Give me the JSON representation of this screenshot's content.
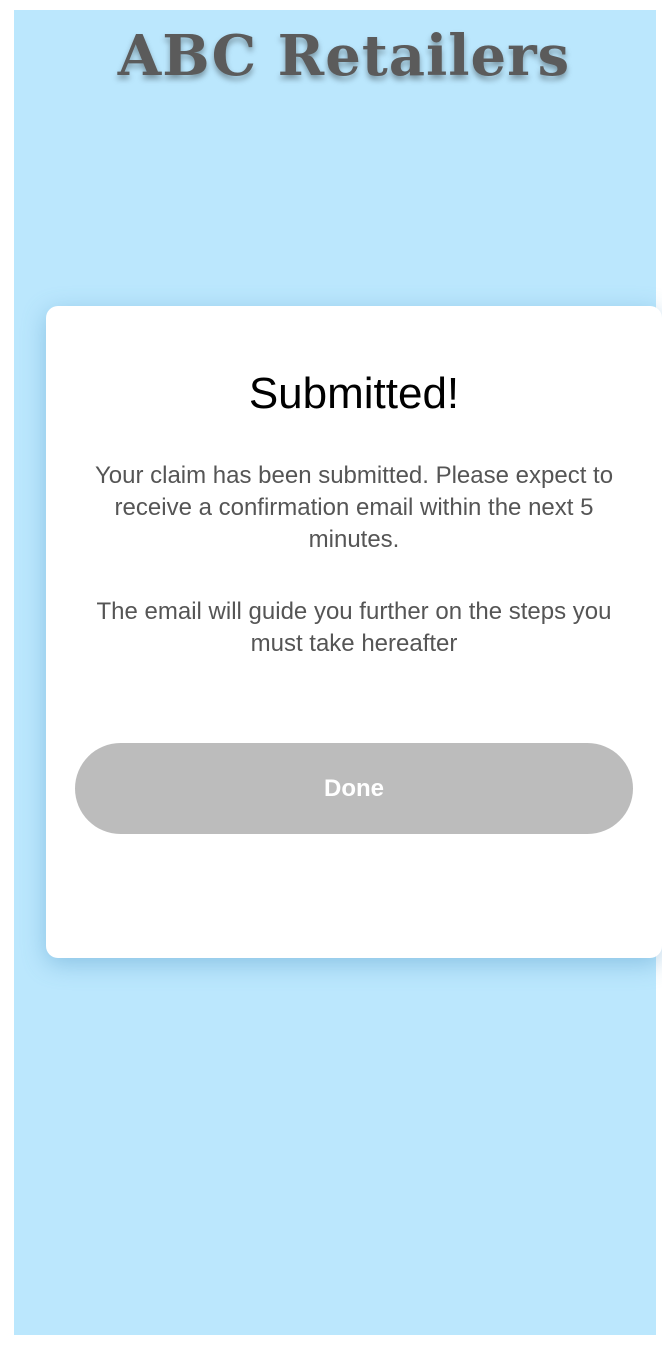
{
  "app": {
    "brand_name": "ABC Retailers"
  },
  "modal": {
    "title": "Submitted!",
    "message_1": "Your claim has been submitted. Please expect to receive a confirmation email within the next 5 minutes.",
    "message_2": "The email will guide you further on the steps you must take hereafter",
    "done_label": "Done"
  },
  "colors": {
    "background": "#bbe7fd",
    "modal_background": "#ffffff",
    "button_disabled": "#bcbcbc",
    "brand_text": "#5b5b5b"
  }
}
